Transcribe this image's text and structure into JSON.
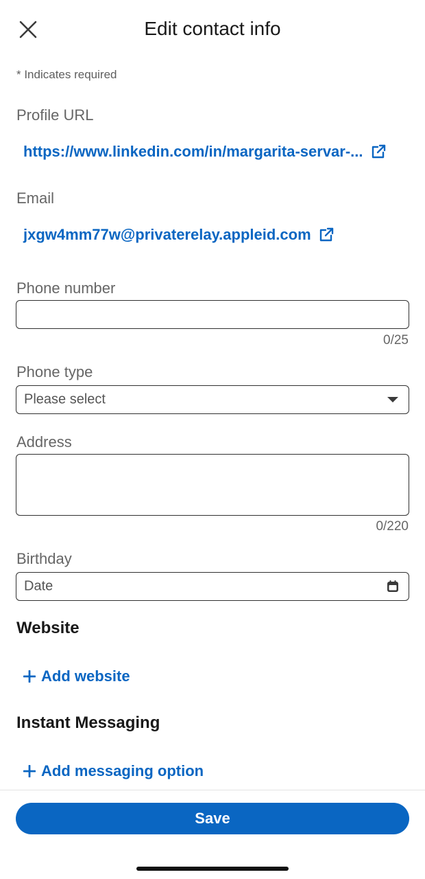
{
  "header": {
    "title": "Edit contact info",
    "close_icon": "close-icon"
  },
  "required_note": "* Indicates required",
  "profile_url": {
    "label": "Profile URL",
    "value": "https://www.linkedin.com/in/margarita-servar-...",
    "icon": "external-link-icon"
  },
  "email": {
    "label": "Email",
    "value": "jxgw4mm77w@privaterelay.appleid.com",
    "icon": "external-link-icon"
  },
  "phone_number": {
    "label": "Phone number",
    "value": "",
    "counter": "0/25"
  },
  "phone_type": {
    "label": "Phone type",
    "selected": "Please select",
    "icon": "caret-down-icon"
  },
  "address": {
    "label": "Address",
    "value": "",
    "counter": "0/220"
  },
  "birthday": {
    "label": "Birthday",
    "placeholder": "Date",
    "icon": "calendar-icon"
  },
  "website": {
    "heading": "Website",
    "add_label": "Add website"
  },
  "instant_messaging": {
    "heading": "Instant Messaging",
    "add_label": "Add messaging option"
  },
  "footer": {
    "save_label": "Save"
  },
  "colors": {
    "accent": "#0a66c2",
    "text": "#191919",
    "muted": "#666666"
  }
}
